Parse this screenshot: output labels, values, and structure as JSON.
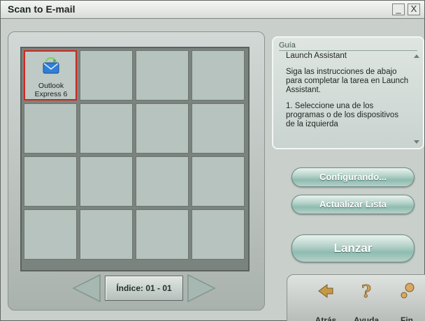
{
  "window": {
    "title": "Scan to E-mail",
    "minimize_label": "_",
    "close_label": "X"
  },
  "grid": {
    "rows": 4,
    "columns": 4,
    "items": [
      {
        "label_line1": "Outlook",
        "label_line2": "Express 6",
        "icon": "outlook-express-icon",
        "selected": true
      }
    ]
  },
  "pager": {
    "index_label": "Índice: 01 - 01",
    "prev_icon": "left-arrow-icon",
    "next_icon": "right-arrow-icon"
  },
  "guide": {
    "title": "Guía",
    "paragraphs": [
      "Launch Assistant",
      "Siga las instrucciones de abajo para completar la tarea en Launch Assistant.",
      "1. Seleccione una de los programas o de los dispositivos  de la izquierda"
    ]
  },
  "actions": {
    "configure_label": "Configurando...",
    "refresh_label": "Actualizar Lista",
    "launch_label": "Lanzar"
  },
  "bottom_nav": {
    "back_label": "Atrás",
    "help_label": "Ayuda",
    "finish_label": "Fin"
  },
  "colors": {
    "accent": "#8ebcb0",
    "selection_border": "#d0261e",
    "panel": "#c9cfcb"
  }
}
